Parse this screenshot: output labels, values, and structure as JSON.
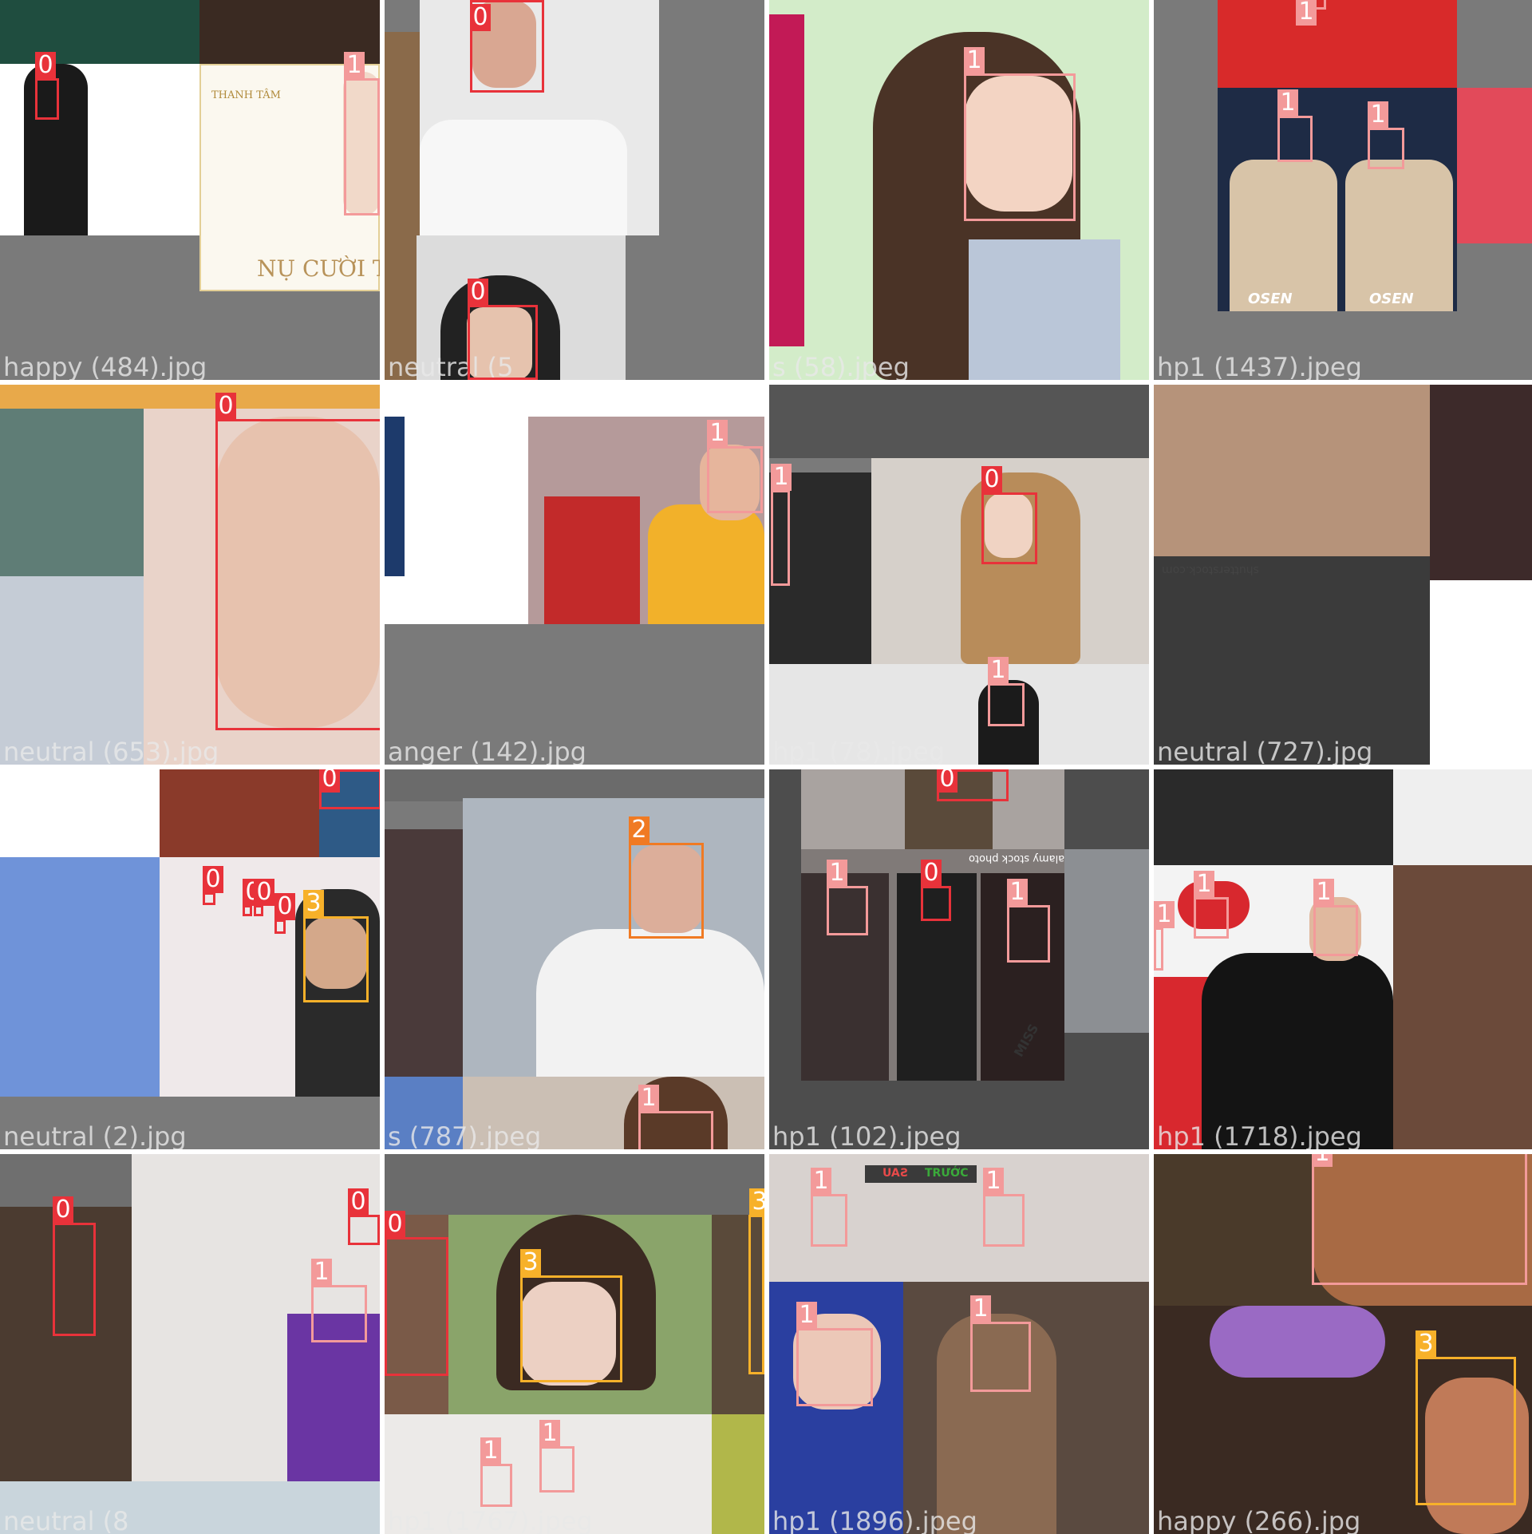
{
  "class_colors": {
    "0": "#e8323a",
    "1": "#f39a9a",
    "2": "#f07a23",
    "3": "#f7b12a"
  },
  "tiles": [
    {
      "caption": "happy (484).jpg"
    },
    {
      "caption": "neutral (5"
    },
    {
      "caption": "s (58).jpeg"
    },
    {
      "caption": "hp1 (1437).jpeg"
    },
    {
      "caption": "neutral (653).jpg"
    },
    {
      "caption": "anger (142).jpg"
    },
    {
      "caption": "hp1 (78).jpeg"
    },
    {
      "caption": "neutral (727).jpg"
    },
    {
      "caption": "neutral (2).jpg"
    },
    {
      "caption": "s (787).jpeg"
    },
    {
      "caption": "hp1 (102).jpeg"
    },
    {
      "caption": "hp1 (1718).jpeg"
    },
    {
      "caption": "neutral (8"
    },
    {
      "caption": "hp1 (1767).jpeg"
    },
    {
      "caption": "hp1 (1896).jpeg"
    },
    {
      "caption": "happy (266).jpg"
    }
  ],
  "image_text": {
    "brand_thanh_tam": "THANH TÂM",
    "nu_cuoi": "NỤ CƯỜI TR",
    "osen_1": "OSEN",
    "osen_2": "OSEN",
    "shutterstock": "shutterstock.com",
    "alamy": "alamy stock photo",
    "miss": "MISS",
    "truoc": "TRƯỚC",
    "sau": "SAU"
  },
  "labels": {
    "l0": "0",
    "l1": "1",
    "l2": "1",
    "l3": "1",
    "l4": "1",
    "l5": "0",
    "l6": "0",
    "l7": "1",
    "l8": "1",
    "l9": "1",
    "l10": "1",
    "l11": "0",
    "l12": "1",
    "l13": "1",
    "l14": "0",
    "l15": "1",
    "l16": "0",
    "l17": "3",
    "l18": "0",
    "l19": "0",
    "l20": "0",
    "l21": "0",
    "l22": "3",
    "l23": "2",
    "l24": "1",
    "l25": "0",
    "l26": "1",
    "l27": "0",
    "l28": "1",
    "l29": "1",
    "l30": "1",
    "l31": "1",
    "l32": "1",
    "l33": "0",
    "l34": "0",
    "l35": "1",
    "l36": "0",
    "l37": "3",
    "l38": "3",
    "l39": "1",
    "l40": "1",
    "l41": "1",
    "l42": "1",
    "l43": "1",
    "l44": "1",
    "l45": "1",
    "l46": "3"
  }
}
